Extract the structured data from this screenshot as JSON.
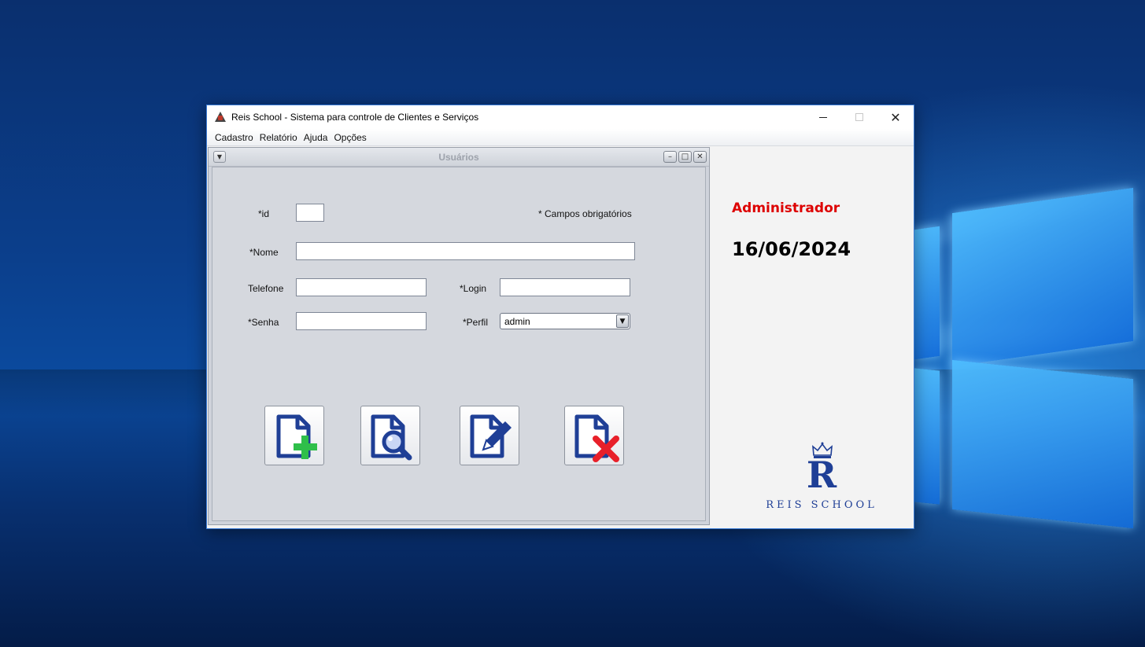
{
  "window": {
    "title": "Reis School - Sistema para controle de Clientes e Serviços",
    "controls": {
      "minimize": "minimize",
      "maximize": "maximize",
      "close": "✕"
    }
  },
  "menu": [
    "Cadastro",
    "Relatório",
    "Ajuda",
    "Opções"
  ],
  "internal_frame": {
    "title": "Usuários",
    "buttons": [
      "minimize",
      "maximize",
      "close"
    ]
  },
  "form": {
    "id_label": "*id",
    "id_value": "",
    "required_note": "* Campos obrigatórios",
    "nome_label": "*Nome",
    "nome_value": "",
    "telefone_label": "Telefone",
    "telefone_value": "",
    "login_label": "*Login",
    "login_value": "",
    "senha_label": "*Senha",
    "senha_value": "",
    "perfil_label": "*Perfil",
    "perfil_value": "admin"
  },
  "actions": [
    {
      "name": "add-user-button",
      "icon": "document-add-icon"
    },
    {
      "name": "search-user-button",
      "icon": "document-search-icon"
    },
    {
      "name": "edit-user-button",
      "icon": "document-edit-icon"
    },
    {
      "name": "delete-user-button",
      "icon": "document-delete-icon"
    }
  ],
  "side_panel": {
    "user_role": "Administrador",
    "date": "16/06/2024",
    "logo_letter": "R",
    "logo_text": "REIS SCHOOL"
  },
  "colors": {
    "accent_blue": "#1f3f96",
    "user_role_red": "#dd0000",
    "add_green": "#2fbf4a",
    "delete_red": "#e8202a"
  }
}
